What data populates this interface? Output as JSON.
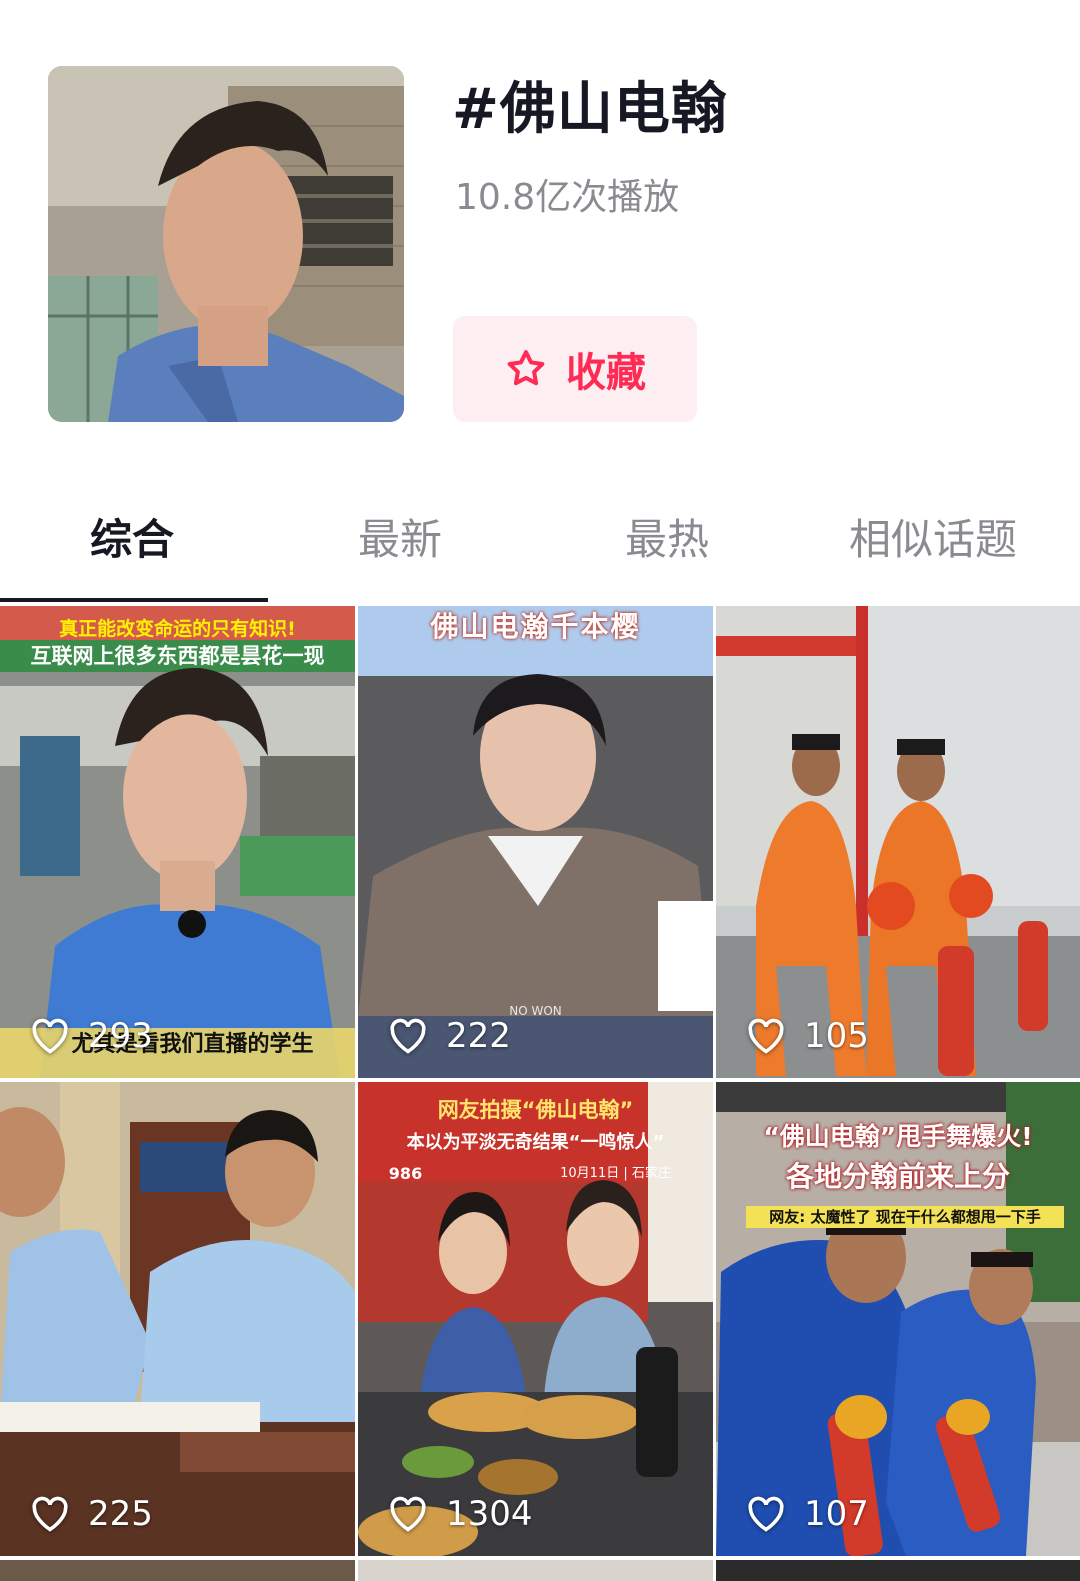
{
  "topic": {
    "title": "#佛山电翰",
    "play_count": "10.8亿次播放",
    "collect_label": "收藏",
    "accent_color": "#fe2c55"
  },
  "tabs": [
    {
      "label": "综合",
      "active": true
    },
    {
      "label": "最新",
      "active": false
    },
    {
      "label": "最热",
      "active": false
    },
    {
      "label": "相似话题",
      "active": false
    }
  ],
  "videos": [
    {
      "likes": "293",
      "overlay": [
        "真正能改变命运的只有知识!",
        "互联网上很多东西都是昙花一现",
        "尤其是看我们直播的学生"
      ]
    },
    {
      "likes": "222",
      "overlay": [
        "佛山电瀚千本樱",
        "NO WON"
      ]
    },
    {
      "likes": "105",
      "overlay": []
    },
    {
      "likes": "225",
      "overlay": []
    },
    {
      "likes": "1304",
      "overlay": [
        "网友拍摄“佛山电翰”",
        "本以为平淡无奇结果“一鸣惊人”",
        "10月11日 | 石家庄",
        "986"
      ]
    },
    {
      "likes": "107",
      "overlay": [
        "“佛山电翰”甩手舞爆火!",
        "各地分翰前来上分",
        "网友: 太魔性了 现在干什么都想甩一下手"
      ]
    }
  ]
}
